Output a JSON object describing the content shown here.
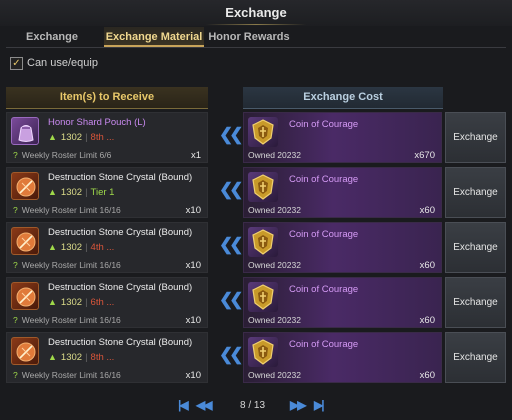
{
  "window": {
    "title": "Exchange"
  },
  "tabs": [
    {
      "label": "Exchange"
    },
    {
      "label": "Exchange Material"
    },
    {
      "label": "Honor Rewards"
    }
  ],
  "filter": {
    "label": "Can use/equip",
    "checked": true
  },
  "columns": {
    "receive": "Item(s) to Receive",
    "cost": "Exchange Cost"
  },
  "rows": [
    {
      "item_name": "Honor Shard Pouch (L)",
      "item_color": "purple",
      "icon": "shard-pouch-icon",
      "level": "1302",
      "extra": "8th ...",
      "extra_color": "red",
      "limit": "Weekly Roster Limit 6/6",
      "qty": "x1",
      "cost_name": "Coin of Courage",
      "owned": "Owned 20232",
      "cost_qty": "x670",
      "button": "Exchange"
    },
    {
      "item_name": "Destruction Stone Crystal (Bound)",
      "item_color": "white",
      "icon": "destruction-stone-icon",
      "level": "1302",
      "extra": "Tier 1",
      "extra_color": "green",
      "limit": "Weekly Roster Limit 16/16",
      "qty": "x10",
      "cost_name": "Coin of Courage",
      "owned": "Owned 20232",
      "cost_qty": "x60",
      "button": "Exchange"
    },
    {
      "item_name": "Destruction Stone Crystal (Bound)",
      "item_color": "white",
      "icon": "destruction-stone-icon",
      "level": "1302",
      "extra": "4th ...",
      "extra_color": "red",
      "limit": "Weekly Roster Limit 16/16",
      "qty": "x10",
      "cost_name": "Coin of Courage",
      "owned": "Owned 20232",
      "cost_qty": "x60",
      "button": "Exchange"
    },
    {
      "item_name": "Destruction Stone Crystal (Bound)",
      "item_color": "white",
      "icon": "destruction-stone-icon",
      "level": "1302",
      "extra": "6th ...",
      "extra_color": "red",
      "limit": "Weekly Roster Limit 16/16",
      "qty": "x10",
      "cost_name": "Coin of Courage",
      "owned": "Owned 20232",
      "cost_qty": "x60",
      "button": "Exchange"
    },
    {
      "item_name": "Destruction Stone Crystal (Bound)",
      "item_color": "white",
      "icon": "destruction-stone-icon",
      "level": "1302",
      "extra": "8th ...",
      "extra_color": "red",
      "limit": "Weekly Roster Limit 16/16",
      "qty": "x10",
      "cost_name": "Coin of Courage",
      "owned": "Owned 20232",
      "cost_qty": "x60",
      "button": "Exchange"
    }
  ],
  "pagination": {
    "current": "8 / 13"
  },
  "colors": {
    "accent_gold": "#e8c86a",
    "link_blue": "#4a8ad8",
    "cost_purple": "#4a2a66"
  }
}
